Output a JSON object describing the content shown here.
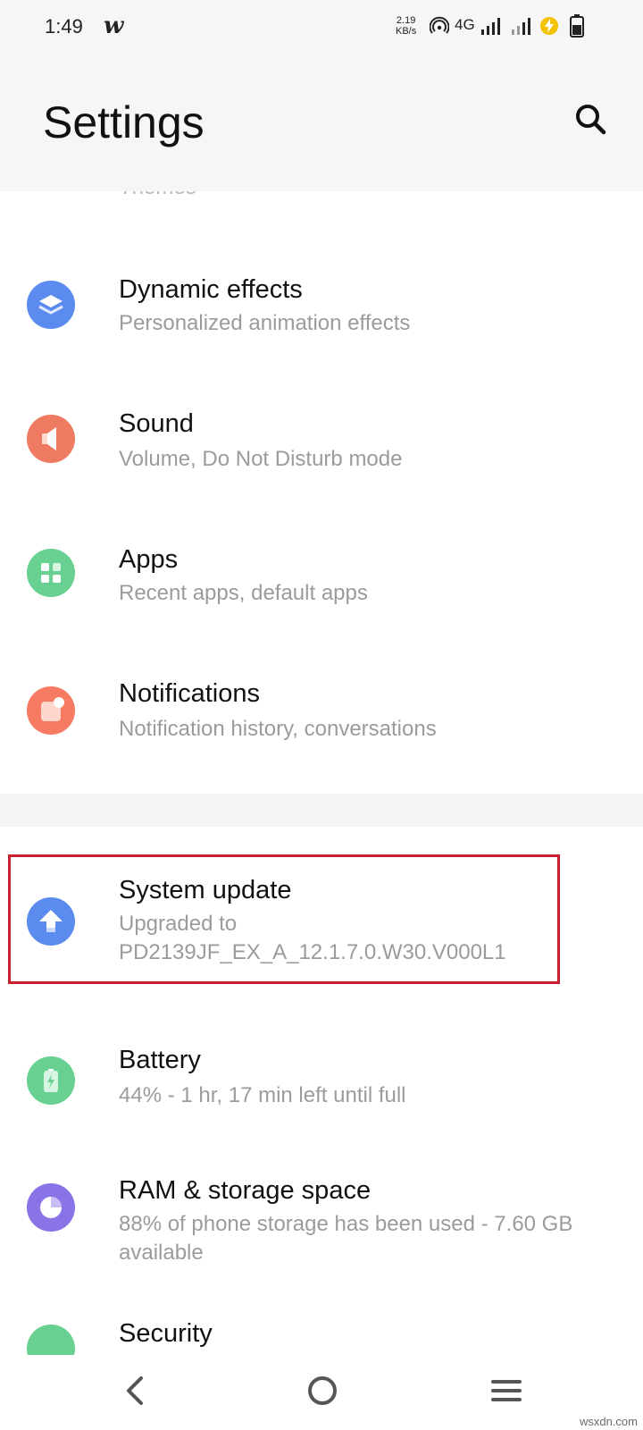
{
  "status_bar": {
    "time": "1:49",
    "app_glyph": "w",
    "net_speed_value": "2.19",
    "net_speed_unit": "KB/s",
    "network_type": "4G",
    "battery_icon": "battery-icon"
  },
  "header": {
    "title": "Settings",
    "search_icon": "search-icon"
  },
  "items": [
    {
      "title": "",
      "subtitle": "Themes",
      "icon": "themes-icon",
      "color": "#7a6bd6"
    },
    {
      "title": "Dynamic effects",
      "subtitle": "Personalized animation effects",
      "icon": "layers-icon",
      "color": "#5b8bef"
    },
    {
      "title": "Sound",
      "subtitle": "Volume, Do Not Disturb mode",
      "icon": "speaker-icon",
      "color": "#ef7a62"
    },
    {
      "title": "Apps",
      "subtitle": "Recent apps, default apps",
      "icon": "apps-grid-icon",
      "color": "#68d192"
    },
    {
      "title": "Notifications",
      "subtitle": "Notification history, conversations",
      "icon": "notification-icon",
      "color": "#f77b63"
    },
    {
      "title": "System update",
      "subtitle": "Upgraded to PD2139JF_EX_A_12.1.7.0.W30.V000L1",
      "icon": "upload-arrow-icon",
      "color": "#5b8bef"
    },
    {
      "title": "Battery",
      "subtitle": "44% - 1 hr, 17 min left until full",
      "icon": "battery-charging-icon",
      "color": "#68d192"
    },
    {
      "title": "RAM & storage space",
      "subtitle": "88% of phone storage has been used - 7.60 GB available",
      "icon": "pie-storage-icon",
      "color": "#8a73e6"
    },
    {
      "title": "Security",
      "subtitle": "",
      "icon": "shield-icon",
      "color": "#68d192"
    }
  ],
  "nav": {
    "back_icon": "back-icon",
    "home_icon": "home-icon",
    "menu_icon": "menu-icon"
  },
  "watermark": "wsxdn.com"
}
